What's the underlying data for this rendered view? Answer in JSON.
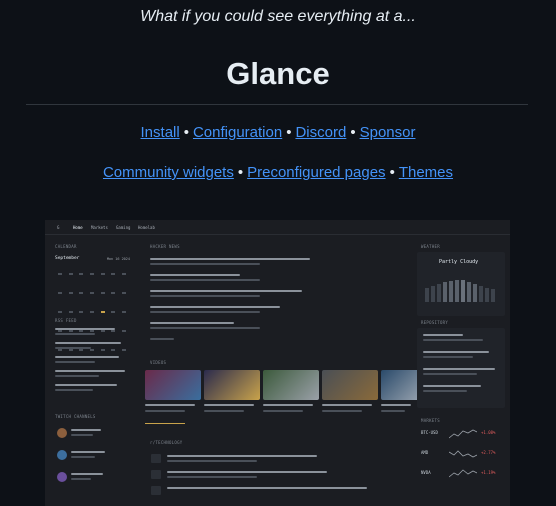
{
  "header": {
    "tagline": "What if you could see everything at a...",
    "title": "Glance"
  },
  "links_row1": [
    {
      "label": "Install"
    },
    {
      "label": "Configuration"
    },
    {
      "label": "Discord"
    },
    {
      "label": "Sponsor"
    }
  ],
  "links_row2": [
    {
      "label": "Community widgets"
    },
    {
      "label": "Preconfigured pages"
    },
    {
      "label": "Themes"
    }
  ],
  "separator": "•",
  "preview": {
    "nav": [
      "Home",
      "Markets",
      "Gaming",
      "Homelab"
    ],
    "calendar_title": "CALENDAR",
    "month": "September",
    "next": "Mon 16  2024",
    "hn_title": "HACKER NEWS",
    "weather_title": "WEATHER",
    "weather_status": "Partly Cloudy",
    "videos_title": "VIDEOS",
    "markets_title": "MARKETS",
    "markets": [
      {
        "symbol": "BTC-USD",
        "change": "+1.08%",
        "color": "#e05c5c"
      },
      {
        "symbol": "AMD",
        "change": "+2.77%",
        "color": "#e05c5c"
      },
      {
        "symbol": "NVDA",
        "change": "+1.19%",
        "color": "#e05c5c"
      }
    ]
  },
  "colors": {
    "link": "#4493f8",
    "bg": "#0d1117",
    "accent": "#c9a34b"
  }
}
